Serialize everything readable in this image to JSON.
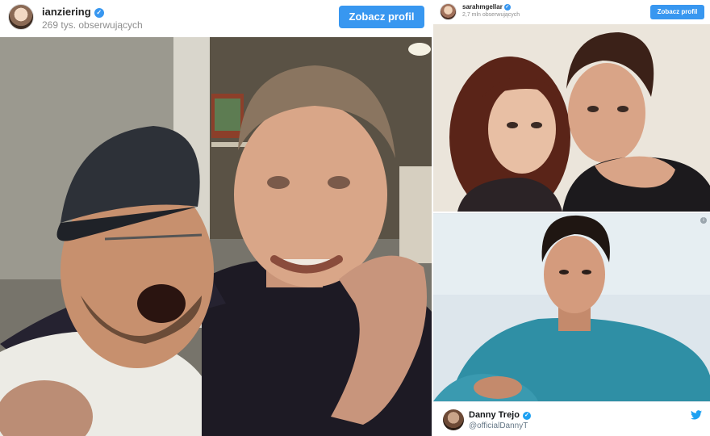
{
  "instagram_main": {
    "username": "ianziering",
    "verified_icon": "verified-badge-icon",
    "followers": "269 tys. obserwujących",
    "profile_button": "Zobacz profil",
    "photo_alt": "two-men-smiling-photo"
  },
  "instagram_secondary": {
    "username": "sarahmgellar",
    "verified_icon": "verified-badge-icon",
    "followers": "2,7 mln obserwujących",
    "profile_button": "Zobacz profil",
    "photo_alt": "couple-embrace-photo"
  },
  "twitter_embed": {
    "display_name": "Danny Trejo",
    "handle": "@officialDannyT",
    "verified_icon": "verified-badge-icon",
    "brand_icon": "twitter-bird-icon",
    "info_icon": "info-icon",
    "photo_alt": "man-in-blue-shirt-photo"
  },
  "colors": {
    "instagram_blue": "#3897f0",
    "twitter_blue": "#1da1f2",
    "muted_text": "#8e8e8e"
  }
}
